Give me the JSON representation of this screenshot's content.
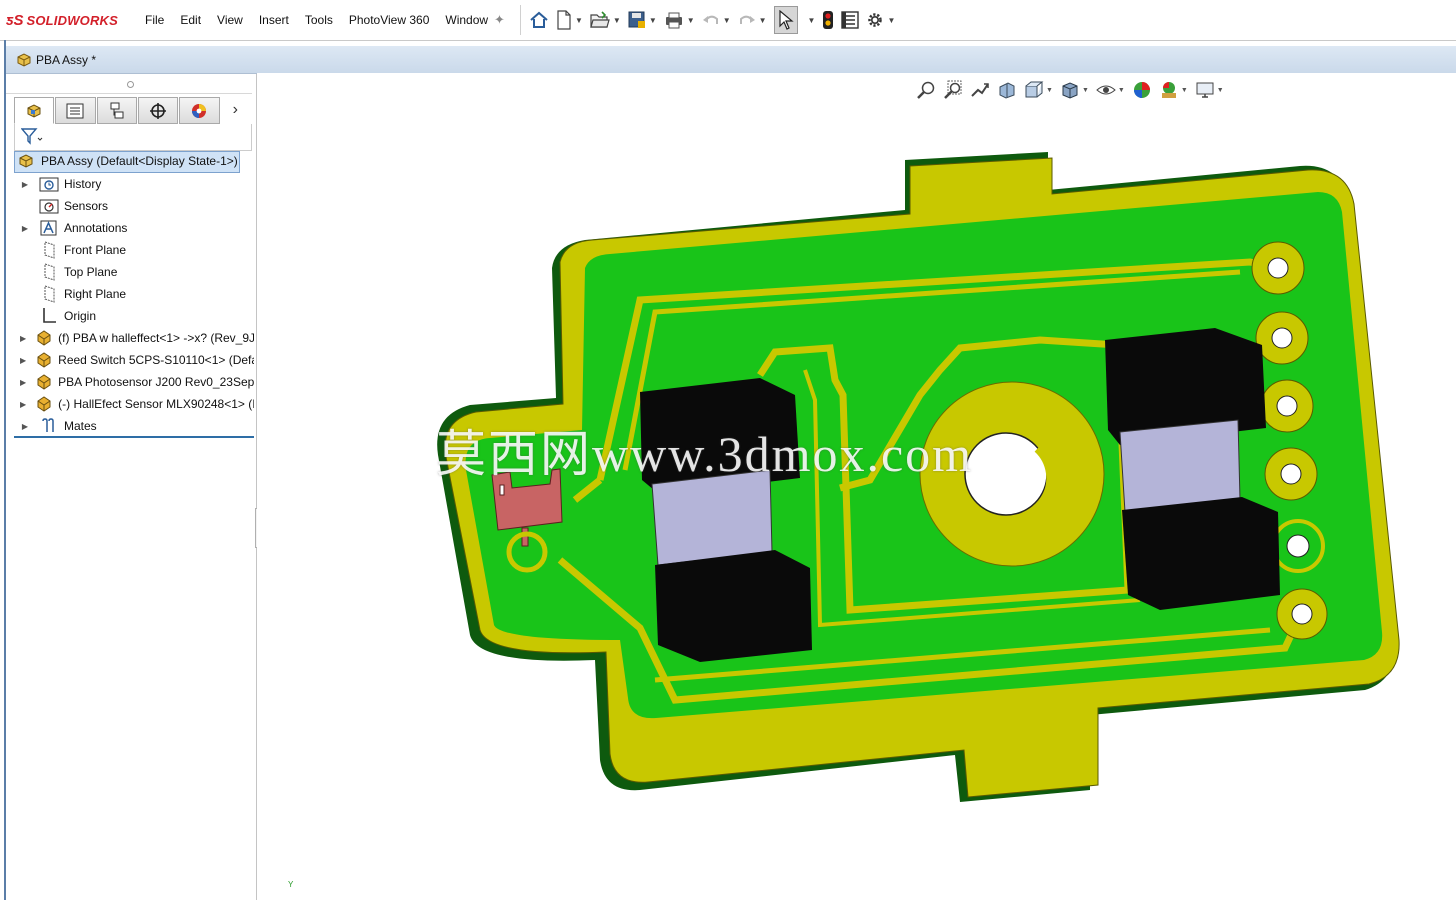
{
  "app": {
    "name": "SOLIDWORKS",
    "brand_color": "#d3202a"
  },
  "menu": {
    "items": [
      "File",
      "Edit",
      "View",
      "Insert",
      "Tools",
      "PhotoView 360",
      "Window"
    ],
    "pin_icon": "pin-icon"
  },
  "toolbar": {
    "icons": [
      "home-icon",
      "new-document-icon",
      "open-folder-icon",
      "save-icon",
      "print-icon",
      "undo-icon",
      "redo-icon",
      "select-pointer-icon",
      "rebuild-traffic-light-icon",
      "file-properties-icon",
      "options-gear-icon"
    ]
  },
  "document": {
    "title": "PBA Assy *"
  },
  "feature_manager": {
    "tabs": [
      "feature-manager-tab",
      "property-manager-tab",
      "configuration-manager-tab",
      "dimxpert-manager-tab",
      "display-manager-tab"
    ],
    "more": "›",
    "root": "PBA Assy  (Default<Display State-1>)",
    "items": [
      {
        "label": "History",
        "icon": "history-folder-icon",
        "expandable": true
      },
      {
        "label": "Sensors",
        "icon": "sensors-folder-icon",
        "expandable": false
      },
      {
        "label": "Annotations",
        "icon": "annotations-icon",
        "expandable": true
      },
      {
        "label": "Front Plane",
        "icon": "plane-icon",
        "expandable": false
      },
      {
        "label": "Top Plane",
        "icon": "plane-icon",
        "expandable": false
      },
      {
        "label": "Right Plane",
        "icon": "plane-icon",
        "expandable": false
      },
      {
        "label": "Origin",
        "icon": "origin-icon",
        "expandable": false
      },
      {
        "label": "(f) PBA w halleffect<1> ->x? (Rev_9J",
        "icon": "part-icon",
        "expandable": true
      },
      {
        "label": "Reed Switch 5CPS-S10110<1> (Defau",
        "icon": "part-icon",
        "expandable": true
      },
      {
        "label": "PBA Photosensor J200 Rev0_23Sep19",
        "icon": "part-icon",
        "expandable": true
      },
      {
        "label": "(-) HallEfect Sensor MLX90248<1> (I",
        "icon": "part-icon",
        "expandable": true
      },
      {
        "label": "Mates",
        "icon": "mates-icon",
        "expandable": true
      }
    ]
  },
  "heads_up_toolbar": {
    "icons": [
      "zoom-to-fit-icon",
      "zoom-to-area-icon",
      "previous-view-icon",
      "section-view-icon",
      "view-orientation-icon",
      "display-style-icon",
      "hide-show-items-icon",
      "edit-appearance-icon",
      "apply-scene-icon",
      "view-settings-icon"
    ]
  },
  "viewport": {
    "model_name": "PBA Assy",
    "colors": {
      "board_green": "#19c419",
      "board_side": "#0e5a0e",
      "copper_yellow": "#c8c800",
      "component_black": "#0a0a0a",
      "window_lavender": "#b4b4d8",
      "sensor_red": "#c86464"
    },
    "watermark": "莫西网www.3dmox.com",
    "triad_label": "Y"
  }
}
